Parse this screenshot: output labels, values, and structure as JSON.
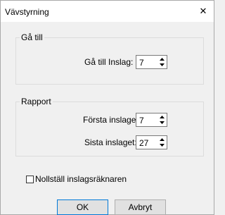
{
  "window": {
    "title": "Vävstyrning",
    "close_glyph": "✕"
  },
  "goto_group": {
    "label": "Gå till",
    "field_label": "Gå till Inslag:",
    "value": "7"
  },
  "report_group": {
    "label": "Rapport",
    "first_label": "Första inslaget:",
    "first_value": "7",
    "last_label": "Sista inslaget:",
    "last_value": "27"
  },
  "reset_checkbox": {
    "label": "Nollställ inslagsräknaren",
    "checked": false
  },
  "buttons": {
    "ok": "OK",
    "cancel": "Avbryt"
  },
  "icons": {
    "spin_up": "triangle-up-icon",
    "spin_down": "triangle-down-icon",
    "close": "close-icon"
  }
}
